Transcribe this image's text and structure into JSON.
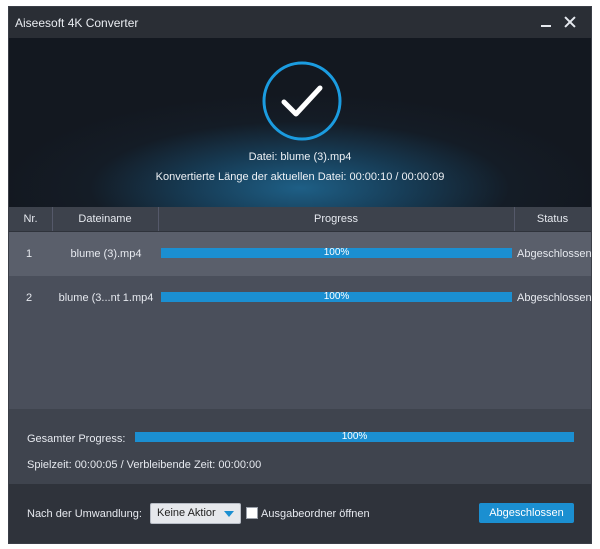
{
  "window": {
    "title": "Aiseesoft 4K Converter"
  },
  "header": {
    "file_line": "Datei: blume (3).mp4",
    "length_line": "Konvertierte Länge der aktuellen Datei: 00:00:10 / 00:00:09",
    "status_icon": "checkmark-circle-icon"
  },
  "table": {
    "columns": [
      "Nr.",
      "Dateiname",
      "Progress",
      "Status"
    ],
    "rows": [
      {
        "nr": "1",
        "name": "blume (3).mp4",
        "progress": "100%",
        "progress_value": 1.0,
        "status": "Abgeschlossen"
      },
      {
        "nr": "2",
        "name": "blume (3...nt 1.mp4",
        "progress": "100%",
        "progress_value": 1.0,
        "status": "Abgeschlossen"
      }
    ]
  },
  "total": {
    "label": "Gesamter Progress:",
    "progress": "100%",
    "progress_value": 1.0,
    "time_line": "Spielzeit: 00:00:05 / Verbleibende Zeit: 00:00:00"
  },
  "footer": {
    "after_label": "Nach der Umwandlung:",
    "select_value": "Keine Aktior",
    "checkbox_label": "Ausgabeordner öffnen",
    "checkbox_checked": false,
    "done_button": "Abgeschlossen"
  },
  "colors": {
    "accent": "#1b8fd1",
    "titlebar": "#2a2e35",
    "body": "#4a4f5b",
    "selected_row": "#5a5f6b"
  }
}
